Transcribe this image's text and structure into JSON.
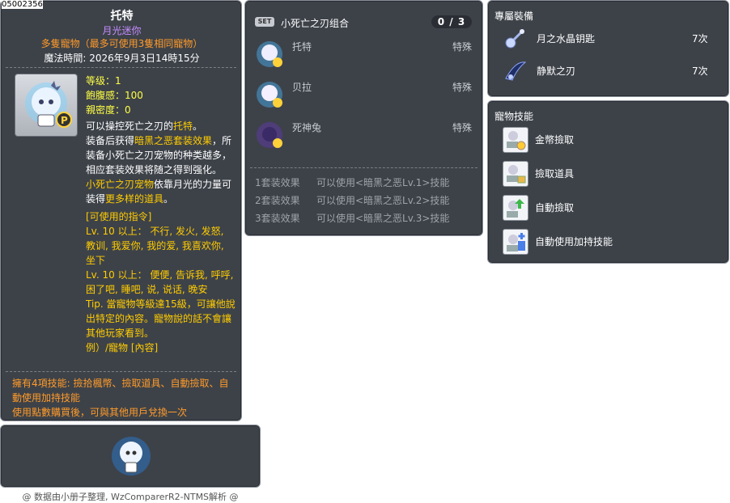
{
  "item_id": "05002356",
  "tooltip": {
    "name": "托特",
    "subtitle": "月光迷你",
    "multi_pet": "多隻寵物（最多可使用3隻相同寵物）",
    "magic_time": "魔法時間: 2026年9月3日14時15分",
    "stats": {
      "level": "等级：1",
      "fullness": "飽腹感：100",
      "closeness": "親密度：0"
    },
    "desc": {
      "p1a": "可以操控死亡之刃的",
      "p1b": "托特",
      "p1c": "。",
      "p2a": "装备后获得",
      "p2b": "暗黑之恶套装效果",
      "p2c": "，所装备小死亡之刃宠物的种类越多，相应套装效果将随之得到强化。",
      "p3a": "小死亡之刃宠物",
      "p3b": "依靠月光的力量可装得",
      "p3c": "更多样的道具",
      "p3d": "。"
    },
    "commands": {
      "header": "[可使用的指令]",
      "lv1": "Lv. 10 以上： 不行, 发火, 发怒, 教训, 我爱你, 我的爱, 我喜欢你, 坐下",
      "lv2": "Lv. 10 以上： 便便, 告诉我, 呼呼, 困了吧, 睡吧, 说, 说话, 晚安",
      "tip": "Tip. 當寵物等級達15級，可讓他說出特定的內容。寵物說的話不會讓其他玩家看到。",
      "example": "例）/寵物 [內容]"
    },
    "skills_summary": "擁有4項技能: 撿拾楓幣、撿取道具、自動撿取、自動使用加持技能",
    "trade_note": "使用點數購買後，可與其他用戶兌換一次"
  },
  "preview": {
    "credit": "@ 数据由小册子整理, WzComparerR2-NTMS解析 @"
  },
  "set": {
    "badge": "SET",
    "title": "小死亡之刃组合",
    "count": "0 / 3",
    "items": [
      {
        "name": "托特",
        "type": "特殊"
      },
      {
        "name": "贝拉",
        "type": "特殊"
      },
      {
        "name": "死神兔",
        "type": "特殊"
      }
    ],
    "effects": [
      {
        "label": "1套装效果",
        "text": "可以使用<暗黑之恶Lv.1>技能"
      },
      {
        "label": "2套装效果",
        "text": "可以使用<暗黑之恶Lv.2>技能"
      },
      {
        "label": "3套装效果",
        "text": "可以使用<暗黑之恶Lv.3>技能"
      }
    ]
  },
  "equip": {
    "title": "專屬裝備",
    "items": [
      {
        "name": "月之水晶钥匙",
        "count": "7次",
        "icon": "crystal-key-icon"
      },
      {
        "name": "静默之刃",
        "count": "7次",
        "icon": "silent-blade-icon"
      }
    ]
  },
  "pet_skills": {
    "title": "寵物技能",
    "items": [
      {
        "name": "金幣撿取",
        "icon": "meso-pickup-icon"
      },
      {
        "name": "撿取道具",
        "icon": "item-pickup-icon"
      },
      {
        "name": "自動撿取",
        "icon": "auto-pickup-icon"
      },
      {
        "name": "自動使用加持技能",
        "icon": "auto-buff-icon"
      }
    ]
  },
  "colors": {
    "panel_bg": "#3d4249",
    "panel_border": "#8a9099",
    "orange": "#ff9a29",
    "yellow": "#ffcc00",
    "purple": "#c58cff"
  }
}
